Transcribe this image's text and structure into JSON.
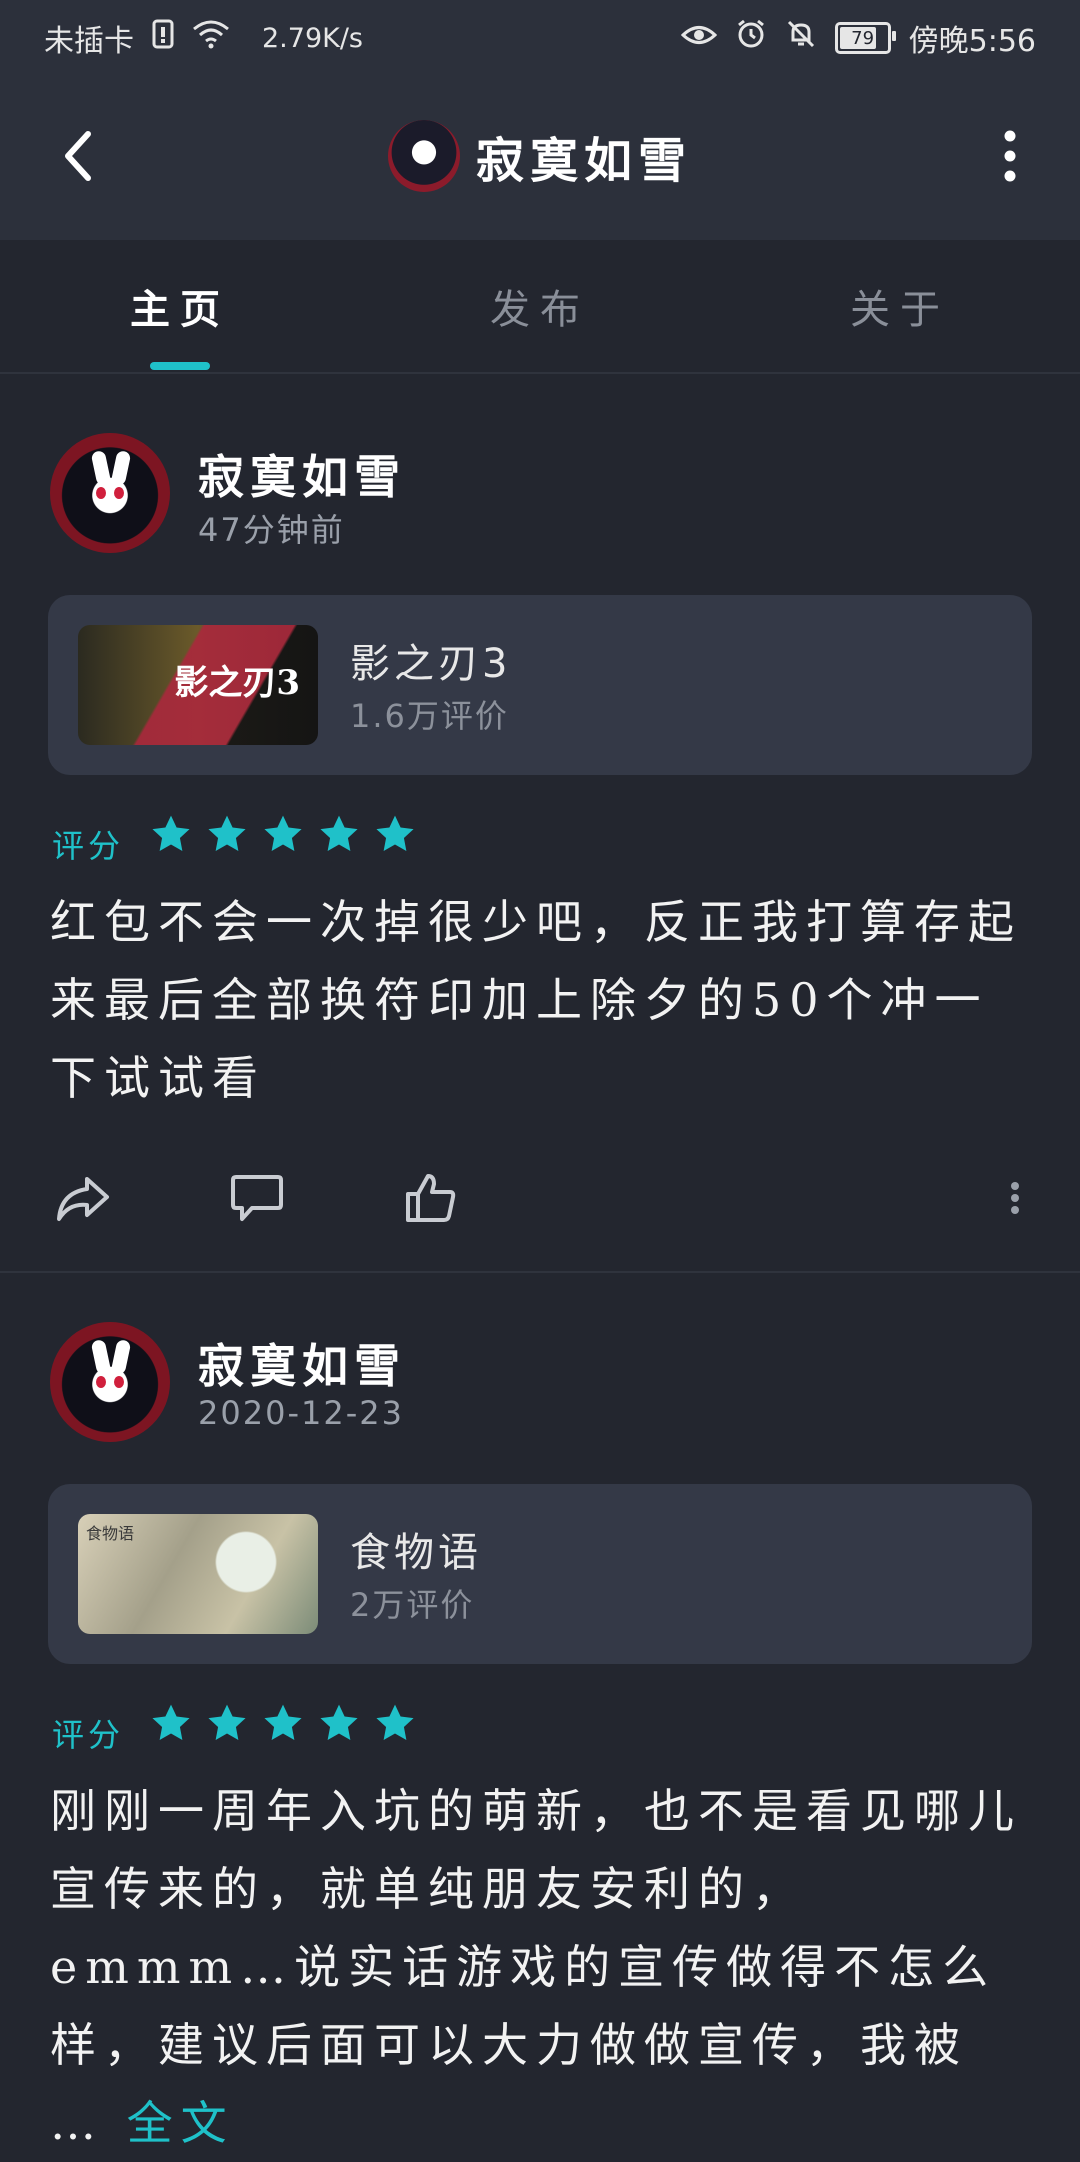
{
  "status_bar": {
    "carrier": "未插卡",
    "speed": "2.79K/s",
    "battery": "79",
    "time": "傍晚5:56"
  },
  "header": {
    "title": "寂寞如雪"
  },
  "tabs": [
    {
      "label": "主页"
    },
    {
      "label": "发布"
    },
    {
      "label": "关于"
    }
  ],
  "posts": [
    {
      "username": "寂寞如雪",
      "time": "47分钟前",
      "game": {
        "name": "影之刃3",
        "reviews": "1.6万评价"
      },
      "rating_label": "评分",
      "rating": 5,
      "text": "红包不会一次掉很少吧，反正我打算存起来最后全部换符印加上除夕的50个冲一下试试看"
    },
    {
      "username": "寂寞如雪",
      "time": "2020-12-23",
      "game": {
        "name": "食物语",
        "reviews": "2万评价"
      },
      "rating_label": "评分",
      "rating": 5,
      "text": "刚刚一周年入坑的萌新，也不是看见哪儿宣传来的，就单纯朋友安利的，emmm…说实话游戏的宣传做得不怎么样，建议后面可以大力做做宣传，我被 …",
      "read_more": "全文"
    }
  ],
  "colors": {
    "background": "#23262f",
    "appbar": "#2c303b",
    "card": "#343947",
    "accent": "#1fc1c9"
  }
}
